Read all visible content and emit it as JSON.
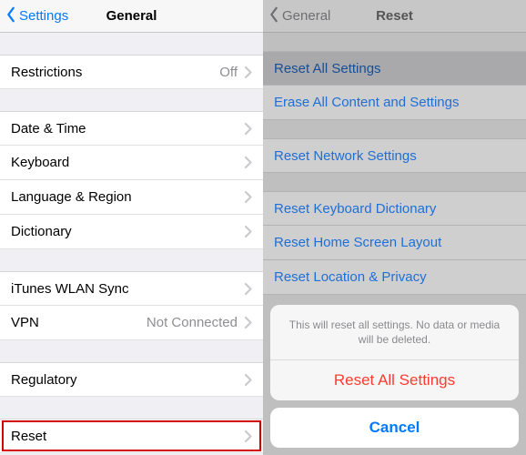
{
  "left": {
    "navbar": {
      "back": "Settings",
      "title": "General"
    },
    "groups": [
      [
        {
          "label": "Restrictions",
          "value": "Off"
        }
      ],
      [
        {
          "label": "Date & Time"
        },
        {
          "label": "Keyboard"
        },
        {
          "label": "Language & Region"
        },
        {
          "label": "Dictionary"
        }
      ],
      [
        {
          "label": "iTunes WLAN Sync"
        },
        {
          "label": "VPN",
          "value": "Not Connected"
        }
      ],
      [
        {
          "label": "Regulatory"
        }
      ],
      [
        {
          "label": "Reset"
        }
      ]
    ]
  },
  "right": {
    "navbar": {
      "back": "General",
      "title": "Reset"
    },
    "groups": [
      [
        {
          "label": "Reset All Settings",
          "active": true
        },
        {
          "label": "Erase All Content and Settings"
        }
      ],
      [
        {
          "label": "Reset Network Settings"
        }
      ],
      [
        {
          "label": "Reset Keyboard Dictionary"
        },
        {
          "label": "Reset Home Screen Layout"
        },
        {
          "label": "Reset Location & Privacy"
        }
      ]
    ],
    "sheet": {
      "message": "This will reset all settings. No data or media will be deleted.",
      "destructive": "Reset All Settings",
      "cancel": "Cancel"
    }
  }
}
